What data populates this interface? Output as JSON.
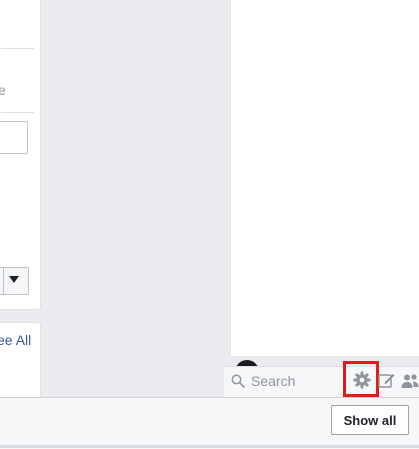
{
  "left_column": {
    "partial_text_e": "e",
    "see_all_link": "ee All"
  },
  "chat_sidebar": {
    "search": {
      "placeholder": "Search"
    },
    "icons": [
      "search-icon",
      "gear-icon",
      "compose-icon",
      "people-icon"
    ],
    "highlight_color": "#e01c1c"
  },
  "bottom_bar": {
    "show_all_label": "Show all"
  },
  "colors": {
    "background": "#e9ebee",
    "link": "#365899",
    "muted_text": "#90949c"
  }
}
